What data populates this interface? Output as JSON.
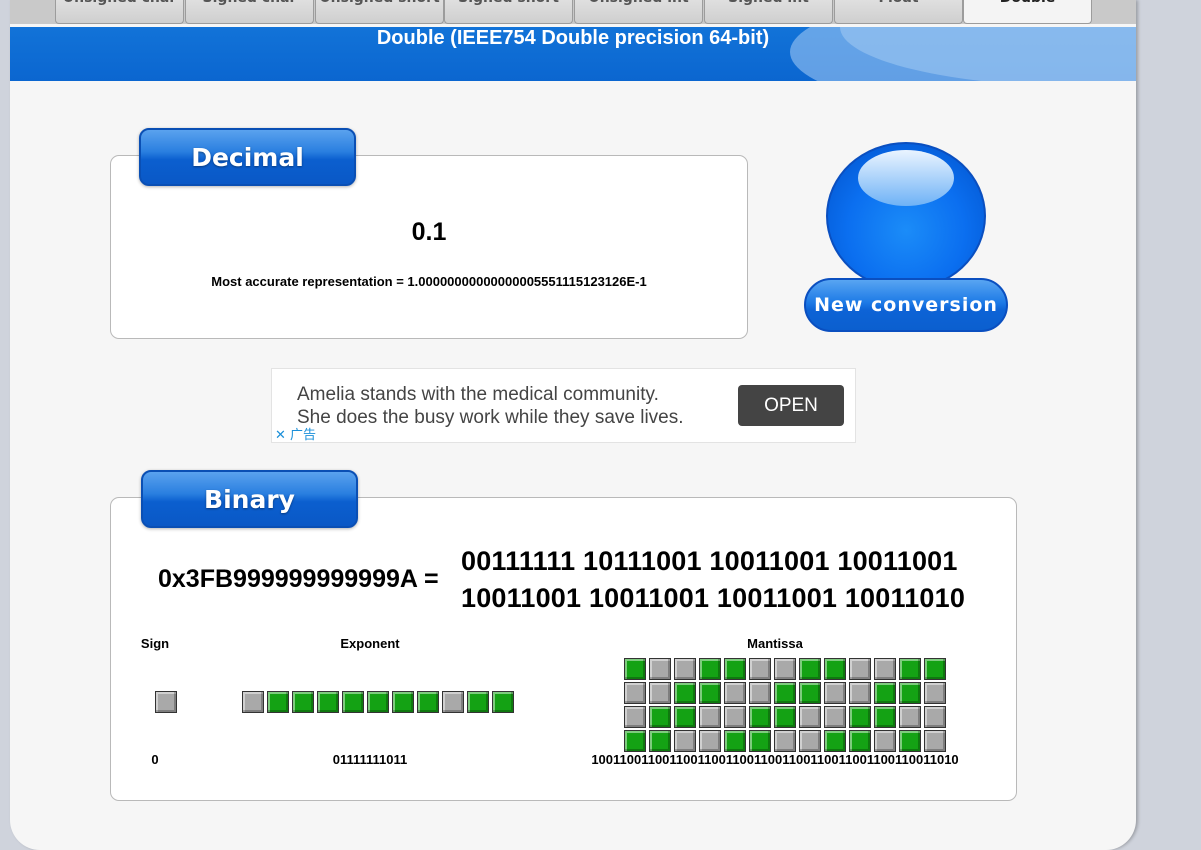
{
  "tabs": [
    {
      "label": "Unsigned char",
      "active": false
    },
    {
      "label": "Signed char",
      "active": false
    },
    {
      "label": "Unsigned short",
      "active": false
    },
    {
      "label": "Signed short",
      "active": false
    },
    {
      "label": "Unsigned int",
      "active": false
    },
    {
      "label": "Signed int",
      "active": false
    },
    {
      "label": "Float",
      "active": false
    },
    {
      "label": "Double",
      "active": true
    }
  ],
  "title": "Double (IEEE754 Double precision 64-bit)",
  "decimal": {
    "label": "Decimal",
    "value": "0.1",
    "accurate": "Most accurate representation = 1.00000000000000005551115123126E-1"
  },
  "new_conversion": {
    "label": "New conversion"
  },
  "ad": {
    "line1": "Amelia stands with the medical community.",
    "line2": "She does the busy work while they save lives.",
    "button": "OPEN",
    "close": "✕ 广告"
  },
  "binary": {
    "label": "Binary",
    "hex": "0x3FB999999999999A =",
    "bits_line1": "00111111 10111001 10011001 10011001",
    "bits_line2": "10011001 10011001 10011001 10011010",
    "sign": {
      "header": "Sign",
      "value": "0"
    },
    "exponent": {
      "header": "Exponent",
      "value": "01111111011"
    },
    "mantissa": {
      "header": "Mantissa",
      "value": "1001100110011001100110011001100110011001100110011010"
    }
  },
  "colors": {
    "bit_one": "#14a214",
    "bit_zero": "#a9a9a9",
    "title_bar": "#0b66d0"
  }
}
